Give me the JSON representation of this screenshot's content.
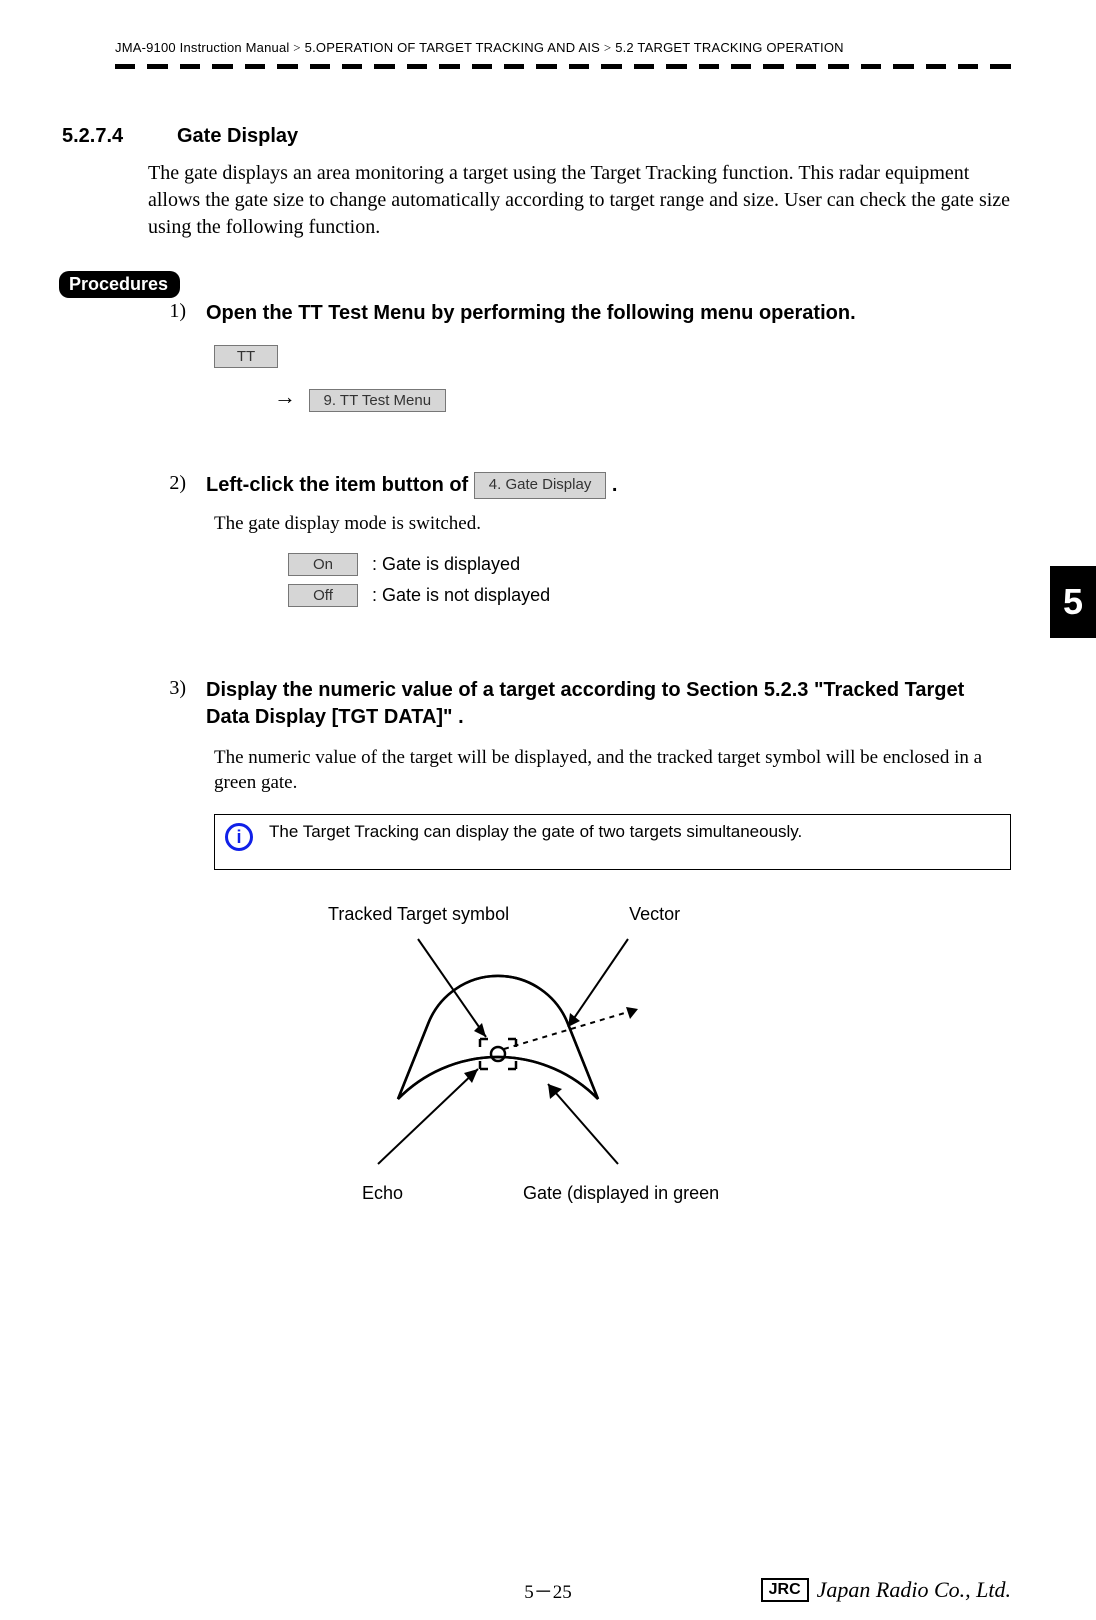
{
  "header": {
    "manual": "JMA-9100 Instruction Manual",
    "chapter": "5.OPERATION OF TARGET TRACKING AND AIS",
    "section": "5.2  TARGET TRACKING OPERATION",
    "gt": ">"
  },
  "sec": {
    "num": "5.2.7.4",
    "title": "Gate Display",
    "intro": "The gate displays an area monitoring a target using the Target Tracking function. This radar equipment allows the gate size to change automatically according to target range and size. User can check the gate size using the following function."
  },
  "procedures_label": "Procedures",
  "steps": {
    "s1": {
      "n": "1)",
      "text": " Open the TT Test Menu by performing the following menu operation.",
      "btn_tt": "TT",
      "arrow": "→",
      "btn_tt_test": "9. TT Test Menu"
    },
    "s2": {
      "n": "2)",
      "text_a": "Left-click the item button of ",
      "btn_gate": "4. Gate Display",
      "text_b": " .",
      "sub": "The gate display mode is switched.",
      "opt_on": "On",
      "opt_on_desc": ": Gate is displayed",
      "opt_off": "Off",
      "opt_off_desc": ": Gate is not displayed"
    },
    "s3": {
      "n": "3)",
      "text": "Display the numeric value of a target according to Section 5.2.3 \"Tracked Target Data Display [TGT DATA]\" .",
      "sub": "The numeric value of the target will be displayed, and the tracked target symbol will be enclosed in a green gate."
    }
  },
  "info": {
    "icon": "i",
    "text": "The Target Tracking can display the gate of two targets simultaneously."
  },
  "diagram": {
    "lbl_tts": "Tracked Target symbol",
    "lbl_vec": "Vector",
    "lbl_echo": "Echo",
    "lbl_gate": "Gate (displayed in green"
  },
  "side_tab": "5",
  "footer": {
    "page": "5－25",
    "jrc": "JRC",
    "company": "Japan Radio Co., Ltd."
  }
}
